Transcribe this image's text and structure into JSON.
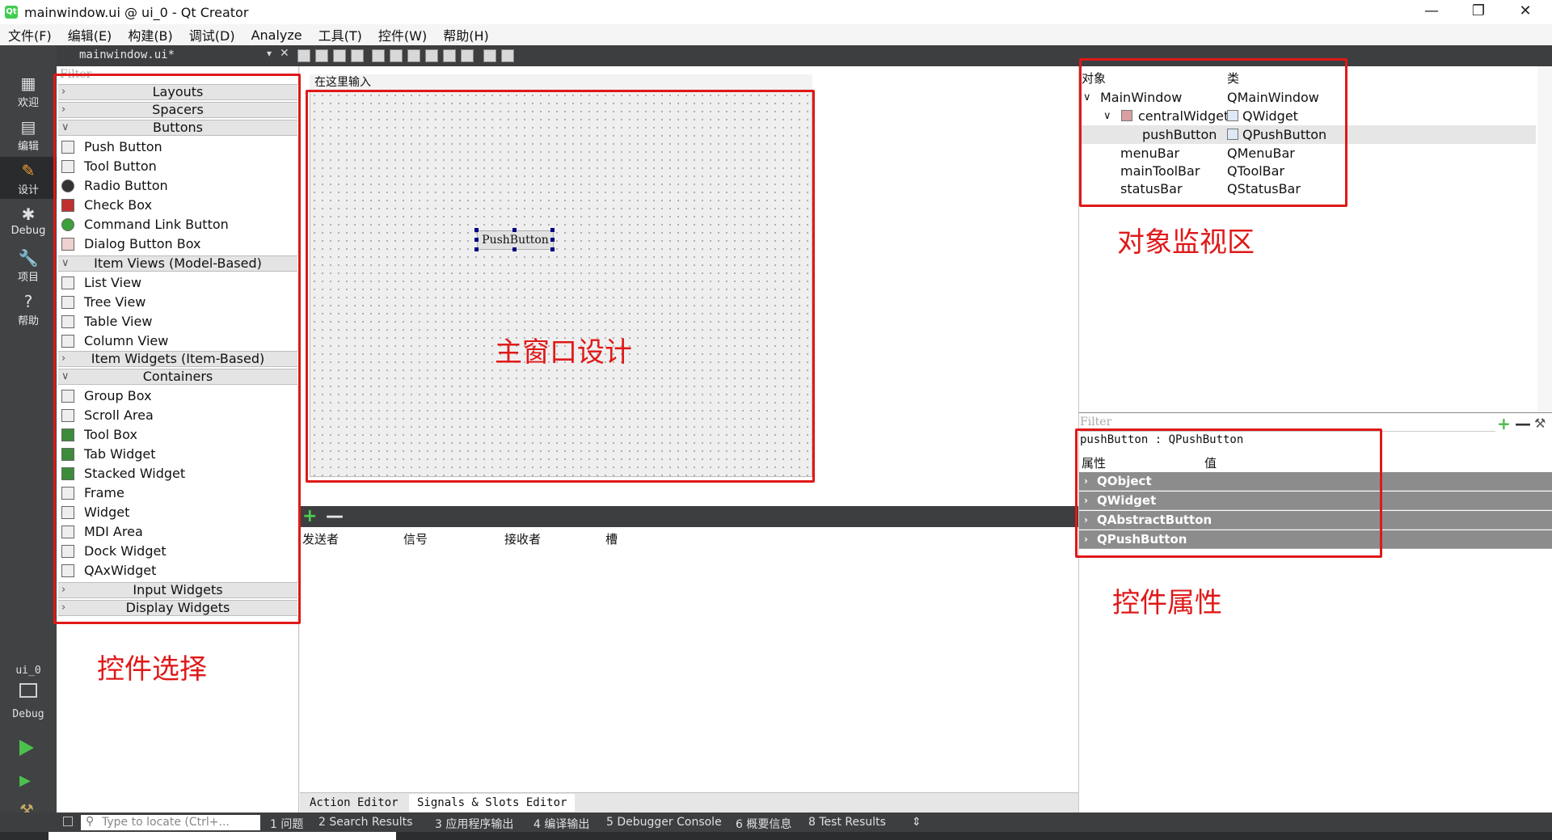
{
  "window": {
    "title": "mainwindow.ui @ ui_0 - Qt Creator",
    "app_icon": "Qt",
    "minimize": "—",
    "maximize": "❐",
    "close": "✕"
  },
  "menubar": [
    "文件(F)",
    "编辑(E)",
    "构建(B)",
    "调试(D)",
    "Analyze",
    "工具(T)",
    "控件(W)",
    "帮助(H)"
  ],
  "modes": [
    {
      "label": "欢迎",
      "glyph": "▦"
    },
    {
      "label": "编辑",
      "glyph": "▤"
    },
    {
      "label": "设计",
      "glyph": "✎"
    },
    {
      "label": "Debug",
      "glyph": "✱"
    },
    {
      "label": "项目",
      "glyph": "🔧"
    },
    {
      "label": "帮助",
      "glyph": "?"
    }
  ],
  "editor_tab": "mainwindow.ui*",
  "widget_box": {
    "filter_placeholder": "Filter",
    "categories": {
      "layouts": "Layouts",
      "spacers": "Spacers",
      "buttons": "Buttons",
      "item_views": "Item Views (Model-Based)",
      "item_widgets": "Item Widgets (Item-Based)",
      "containers": "Containers",
      "input_widgets": "Input Widgets",
      "display_widgets": "Display Widgets"
    },
    "buttons": [
      "Push Button",
      "Tool Button",
      "Radio Button",
      "Check Box",
      "Command Link Button",
      "Dialog Button Box"
    ],
    "item_views": [
      "List View",
      "Tree View",
      "Table View",
      "Column View"
    ],
    "containers": [
      "Group Box",
      "Scroll Area",
      "Tool Box",
      "Tab Widget",
      "Stacked Widget",
      "Frame",
      "Widget",
      "MDI Area",
      "Dock Widget",
      "QAxWidget"
    ]
  },
  "form": {
    "menu_placeholder": "在这里输入",
    "push_button": "PushButton"
  },
  "signals_slots": {
    "add": "+",
    "remove": "—",
    "columns": [
      "发送者",
      "信号",
      "接收者",
      "槽"
    ],
    "tabs": [
      "Action Editor",
      "Signals & Slots Editor"
    ]
  },
  "object_inspector": {
    "headers": [
      "对象",
      "类"
    ],
    "rows": [
      {
        "object": "MainWindow",
        "class": "QMainWindow",
        "arrow": "∨"
      },
      {
        "object": "centralWidget",
        "class": "QWidget",
        "arrow": "∨"
      },
      {
        "object": "pushButton",
        "class": "QPushButton",
        "arrow": ""
      },
      {
        "object": "menuBar",
        "class": "QMenuBar",
        "arrow": ""
      },
      {
        "object": "mainToolBar",
        "class": "QToolBar",
        "arrow": ""
      },
      {
        "object": "statusBar",
        "class": "QStatusBar",
        "arrow": ""
      }
    ]
  },
  "property_editor": {
    "filter_placeholder": "Filter",
    "add": "+",
    "remove": "—",
    "wrench": "⚒",
    "object_label": "pushButton : QPushButton",
    "headers": [
      "属性",
      "值"
    ],
    "groups": [
      "QObject",
      "QWidget",
      "QAbstractButton",
      "QPushButton"
    ]
  },
  "annotations": {
    "widget_select": "控件选择",
    "main_design": "主窗口设计",
    "object_monitor": "对象监视区",
    "widget_props": "控件属性"
  },
  "kit": {
    "project": "ui_0",
    "mode": "Debug"
  },
  "statusbar": {
    "locate_placeholder": "Type to locate (Ctrl+...",
    "panes": [
      "1 问题",
      "2 Search Results",
      "3 应用程序输出",
      "4 编译输出",
      "5 Debugger Console",
      "6 概要信息",
      "8 Test Results"
    ],
    "more": "⇕"
  },
  "colors": {
    "annotation": "#e01818",
    "modebar": "#404244",
    "property_group": "#8c8c8c"
  }
}
